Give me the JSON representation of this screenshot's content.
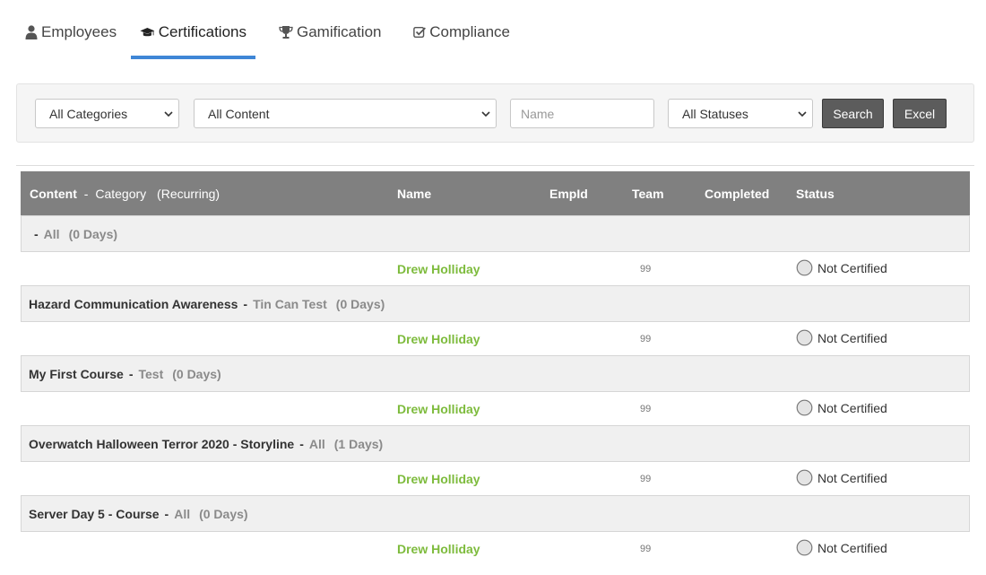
{
  "tabs": [
    {
      "label": "Employees",
      "icon": "user-icon",
      "active": false
    },
    {
      "label": "Certifications",
      "icon": "graduation-cap-icon",
      "active": true
    },
    {
      "label": "Gamification",
      "icon": "trophy-icon",
      "active": false
    },
    {
      "label": "Compliance",
      "icon": "check-square-icon",
      "active": false
    }
  ],
  "filters": {
    "category_selected": "All Categories",
    "content_selected": "All Content",
    "name_placeholder": "Name",
    "status_selected": "All Statuses",
    "search_label": "Search",
    "excel_label": "Excel"
  },
  "table": {
    "headers": {
      "content": "Content",
      "dash": "-",
      "category": "Category",
      "recurring": "(Recurring)",
      "name": "Name",
      "empid": "EmpId",
      "team": "Team",
      "completed": "Completed",
      "status": "Status"
    },
    "groups": [
      {
        "content": "",
        "category": "All",
        "days": "(0 Days)",
        "employee": "Drew Holliday",
        "team": "99",
        "status": "Not Certified"
      },
      {
        "content": "Hazard Communication Awareness",
        "category": "Tin Can Test",
        "days": "(0 Days)",
        "employee": "Drew Holliday",
        "team": "99",
        "status": "Not Certified"
      },
      {
        "content": "My First Course",
        "category": "Test",
        "days": "(0 Days)",
        "employee": "Drew Holliday",
        "team": "99",
        "status": "Not Certified"
      },
      {
        "content": "Overwatch Halloween Terror 2020 - Storyline",
        "category": "All",
        "days": "(1 Days)",
        "employee": "Drew Holliday",
        "team": "99",
        "status": "Not Certified"
      },
      {
        "content": "Server Day 5 - Course",
        "category": "All",
        "days": "(0 Days)",
        "employee": "Drew Holliday",
        "team": "99",
        "status": "Not Certified"
      }
    ]
  }
}
